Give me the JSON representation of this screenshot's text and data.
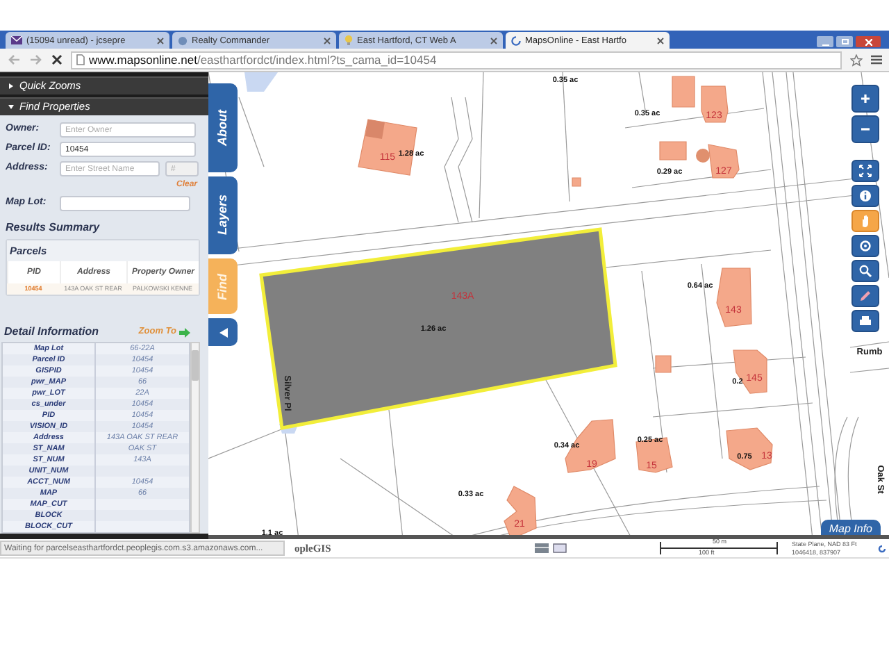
{
  "browser": {
    "tabs": [
      {
        "label": "(15094 unread) - jcsepre",
        "kind": "mail",
        "selected": false
      },
      {
        "label": "Realty Commander",
        "kind": "page",
        "selected": false
      },
      {
        "label": "East Hartford, CT Web A",
        "kind": "bulb",
        "selected": false
      },
      {
        "label": "MapsOnline - East Hartfo",
        "kind": "loading",
        "selected": true
      }
    ],
    "url_domain": "www.mapsonline.net",
    "url_path": "/easthartfordct/index.html?ts_cama_id=10454"
  },
  "sidebar": {
    "sections": [
      {
        "label": "Quick Zooms",
        "expanded": false
      },
      {
        "label": "Find Properties",
        "expanded": true
      }
    ],
    "fields": [
      {
        "label": "Owner:",
        "placeholder": "Enter Owner"
      },
      {
        "label": "Parcel ID:",
        "value": "10454"
      },
      {
        "label": "Address:",
        "placeholder": "Enter Street Name",
        "number_placeholder": "#"
      },
      {
        "label": "Map Lot:"
      }
    ],
    "clear": "Clear",
    "results_title": "Results Summary",
    "results": {
      "title": "Parcels",
      "columns": [
        "PID",
        "Address",
        "Property Owner"
      ],
      "rows": [
        [
          "10454",
          "143A OAK ST REAR",
          "PALKOWSKI KENNE"
        ]
      ]
    },
    "detail": {
      "title": "Detail Information",
      "zoom_to": "Zoom To",
      "rows": [
        {
          "field": "Map Lot",
          "value": "66-22A"
        },
        {
          "field": "Parcel ID",
          "value": "10454"
        },
        {
          "field": "GISPID",
          "value": "10454"
        },
        {
          "field": "pwr_MAP",
          "value": "66"
        },
        {
          "field": "pwr_LOT",
          "value": "22A"
        },
        {
          "field": "cs_under",
          "value": "10454"
        },
        {
          "field": "PID",
          "value": "10454"
        },
        {
          "field": "VISION_ID",
          "value": "10454"
        },
        {
          "field": "Address",
          "value": "143A OAK ST REAR"
        },
        {
          "field": "ST_NAM",
          "value": "OAK ST"
        },
        {
          "field": "ST_NUM",
          "value": "143A"
        },
        {
          "field": "UNIT_NUM"
        },
        {
          "field": "ACCT_NUM",
          "value": "10454"
        },
        {
          "field": "MAP",
          "value": "66"
        },
        {
          "field": "MAP_CUT"
        },
        {
          "field": "BLOCK"
        },
        {
          "field": "BLOCK_CUT"
        }
      ]
    }
  },
  "side_tabs": [
    {
      "label": "About",
      "selected": false
    },
    {
      "label": "Layers",
      "selected": false
    },
    {
      "label": "Find",
      "selected": true
    }
  ],
  "map": {
    "labels": [
      {
        "text": "0.35 ac",
        "kind": "area"
      },
      {
        "text": "0.35 ac",
        "kind": "area"
      },
      {
        "text": "123",
        "kind": "address"
      },
      {
        "text": "0.29 ac",
        "kind": "area"
      },
      {
        "text": "127",
        "kind": "address"
      },
      {
        "text": "115",
        "kind": "address"
      },
      {
        "text": "1.28 ac",
        "kind": "area"
      },
      {
        "text": "143A",
        "kind": "address"
      },
      {
        "text": "1.26 ac",
        "kind": "area"
      },
      {
        "text": "0.64 ac",
        "kind": "area"
      },
      {
        "text": "143",
        "kind": "address"
      },
      {
        "text": "0.2",
        "kind": "area"
      },
      {
        "text": "145",
        "kind": "address"
      },
      {
        "text": "0.34 ac",
        "kind": "area"
      },
      {
        "text": "19",
        "kind": "address"
      },
      {
        "text": "0.25 ac",
        "kind": "area"
      },
      {
        "text": "15",
        "kind": "address"
      },
      {
        "text": "0.75",
        "kind": "area"
      },
      {
        "text": "13",
        "kind": "address"
      },
      {
        "text": "0.33 ac",
        "kind": "area"
      },
      {
        "text": "21",
        "kind": "address"
      },
      {
        "text": "1.1 ac",
        "kind": "area"
      },
      {
        "text": "Silver Pl",
        "kind": "street"
      },
      {
        "text": "Oak St",
        "kind": "street"
      },
      {
        "text": "Rumb",
        "kind": "street"
      }
    ],
    "tools": [
      {
        "kind": "zoom_in",
        "selected": false
      },
      {
        "kind": "zoom_out",
        "selected": false
      },
      {
        "kind": "extent",
        "selected": false
      },
      {
        "kind": "info",
        "selected": false
      },
      {
        "kind": "pan",
        "selected": true
      },
      {
        "kind": "locate",
        "selected": false
      },
      {
        "kind": "zoom_select",
        "selected": false
      },
      {
        "kind": "draw",
        "selected": false
      },
      {
        "kind": "print",
        "selected": false
      }
    ],
    "map_info": "Map Info",
    "footer": {
      "brand": "opleGIS",
      "scale_metric": "50 m",
      "scale_imperial": "100 ft",
      "projection": "State Plane, NAD 83 Ft",
      "coordinates": "1046418, 837907"
    }
  },
  "status": "Waiting for parcelseasthartfordct.peoplegis.com.s3.amazonaws.com..."
}
